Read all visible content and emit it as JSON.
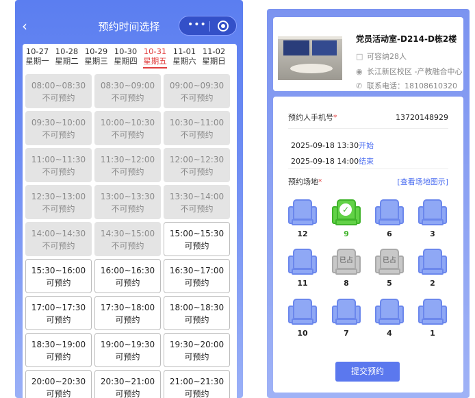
{
  "left": {
    "title": "预约时间选择",
    "capsule_dots": "•••",
    "dates": [
      {
        "date": "10-27",
        "weekday": "星期一"
      },
      {
        "date": "10-28",
        "weekday": "星期二"
      },
      {
        "date": "10-29",
        "weekday": "星期三"
      },
      {
        "date": "10-30",
        "weekday": "星期四"
      },
      {
        "date": "10-31",
        "weekday": "星期五"
      },
      {
        "date": "11-01",
        "weekday": "星期六"
      },
      {
        "date": "11-02",
        "weekday": "星期日"
      }
    ],
    "active_date_index": 4,
    "slots": [
      {
        "time": "08:00~08:30",
        "status": "不可预约",
        "available": false
      },
      {
        "time": "08:30~09:00",
        "status": "不可预约",
        "available": false
      },
      {
        "time": "09:00~09:30",
        "status": "不可预约",
        "available": false
      },
      {
        "time": "09:30~10:00",
        "status": "不可预约",
        "available": false
      },
      {
        "time": "10:00~10:30",
        "status": "不可预约",
        "available": false
      },
      {
        "time": "10:30~11:00",
        "status": "不可预约",
        "available": false
      },
      {
        "time": "11:00~11:30",
        "status": "不可预约",
        "available": false
      },
      {
        "time": "11:30~12:00",
        "status": "不可预约",
        "available": false
      },
      {
        "time": "12:00~12:30",
        "status": "不可预约",
        "available": false
      },
      {
        "time": "12:30~13:00",
        "status": "不可预约",
        "available": false
      },
      {
        "time": "13:00~13:30",
        "status": "不可预约",
        "available": false
      },
      {
        "time": "13:30~14:00",
        "status": "不可预约",
        "available": false
      },
      {
        "time": "14:00~14:30",
        "status": "不可预约",
        "available": false
      },
      {
        "time": "14:30~15:00",
        "status": "不可预约",
        "available": false
      },
      {
        "time": "15:00~15:30",
        "status": "可预约",
        "available": true
      },
      {
        "time": "15:30~16:00",
        "status": "可预约",
        "available": true
      },
      {
        "time": "16:00~16:30",
        "status": "可预约",
        "available": true
      },
      {
        "time": "16:30~17:00",
        "status": "可预约",
        "available": true
      },
      {
        "time": "17:00~17:30",
        "status": "可预约",
        "available": true
      },
      {
        "time": "17:30~18:00",
        "status": "可预约",
        "available": true
      },
      {
        "time": "18:00~18:30",
        "status": "可预约",
        "available": true
      },
      {
        "time": "18:30~19:00",
        "status": "可预约",
        "available": true
      },
      {
        "time": "19:00~19:30",
        "status": "可预约",
        "available": true
      },
      {
        "time": "19:30~20:00",
        "status": "可预约",
        "available": true
      },
      {
        "time": "20:00~20:30",
        "status": "可预约",
        "available": true
      },
      {
        "time": "20:30~21:00",
        "status": "可预约",
        "available": true
      },
      {
        "time": "21:00~21:30",
        "status": "可预约",
        "available": true
      }
    ]
  },
  "right": {
    "room_name": "党员活动室-D214-D栋2楼",
    "capacity": "可容纳28人",
    "location": "长江新区校区  -产教融合中心",
    "contact": "联系电话：18108610320",
    "phone_label": "预约人手机号",
    "phone_value": "13720148929",
    "start_time": "2025-09-18 13:30",
    "start_tag": "开始",
    "end_time": "2025-09-18 14:00",
    "end_tag": "结束",
    "venue_label": "预约场地",
    "required_mark": "*",
    "view_map_link": "[查看场地图示]",
    "occupied_text": "已占",
    "seats": [
      {
        "num": "12",
        "state": "free"
      },
      {
        "num": "9",
        "state": "selected"
      },
      {
        "num": "6",
        "state": "free"
      },
      {
        "num": "3",
        "state": "free"
      },
      {
        "num": "11",
        "state": "free"
      },
      {
        "num": "8",
        "state": "occupied"
      },
      {
        "num": "5",
        "state": "occupied"
      },
      {
        "num": "2",
        "state": "free"
      },
      {
        "num": "10",
        "state": "free"
      },
      {
        "num": "7",
        "state": "free"
      },
      {
        "num": "4",
        "state": "free"
      },
      {
        "num": "1",
        "state": "free"
      }
    ],
    "submit_label": "提交预约"
  }
}
